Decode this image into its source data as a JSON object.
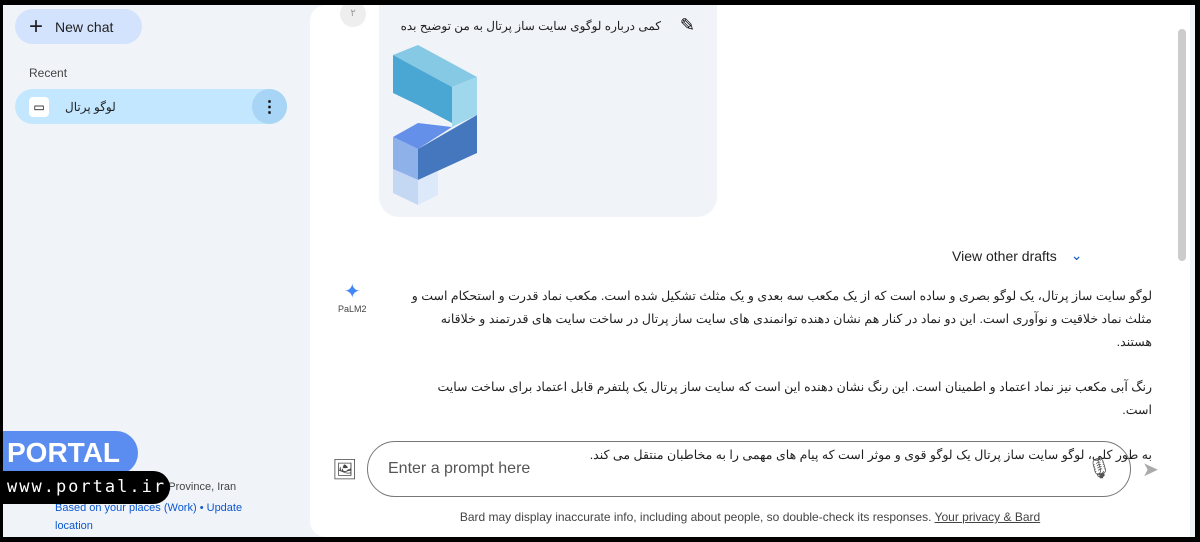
{
  "sidebar": {
    "new_chat": "New chat",
    "recent_label": "Recent",
    "items": [
      {
        "label": "لوگو پرتال"
      }
    ],
    "location": {
      "place": "an Province, Iran",
      "source": "Based on your places (Work)",
      "separator": "•",
      "update": "Update location"
    }
  },
  "watermark": {
    "brand": "PORTAL",
    "url": "www.portal.ir"
  },
  "chat": {
    "user_avatar": "۲",
    "prompt": "کمی درباره لوگوی سایت ساز پرتال به من توضیح بده",
    "view_drafts": "View other drafts",
    "model_label": "PaLM2",
    "response": [
      "لوگو سایت ساز پرتال، یک لوگو بصری و ساده است که از یک مکعب سه بعدی و یک مثلث تشکیل شده است. مکعب نماد قدرت و استحکام است و مثلث نماد خلاقیت و نوآوری است. این دو نماد در کنار هم نشان دهنده توانمندی های سایت ساز پرتال در ساخت سایت های قدرتمند و خلاقانه هستند.",
      "رنگ آبی مکعب نیز نماد اعتماد و اطمینان است. این رنگ نشان دهنده این است که سایت ساز پرتال یک پلتفرم قابل اعتماد برای ساخت سایت است.",
      "به طور کلی، لوگو سایت ساز پرتال یک لوگو قوی و موثر است که پیام های مهمی را به مخاطبان منتقل می کند."
    ]
  },
  "input": {
    "placeholder": "Enter a prompt here"
  },
  "footer": {
    "disclaimer": "Bard may display inaccurate info, including about people, so double-check its responses. ",
    "privacy": "Your privacy & Bard"
  },
  "colors": {
    "accent": "#0b57d0",
    "selected": "#c2e7ff",
    "sidebar_bg": "#f0f4f9"
  }
}
